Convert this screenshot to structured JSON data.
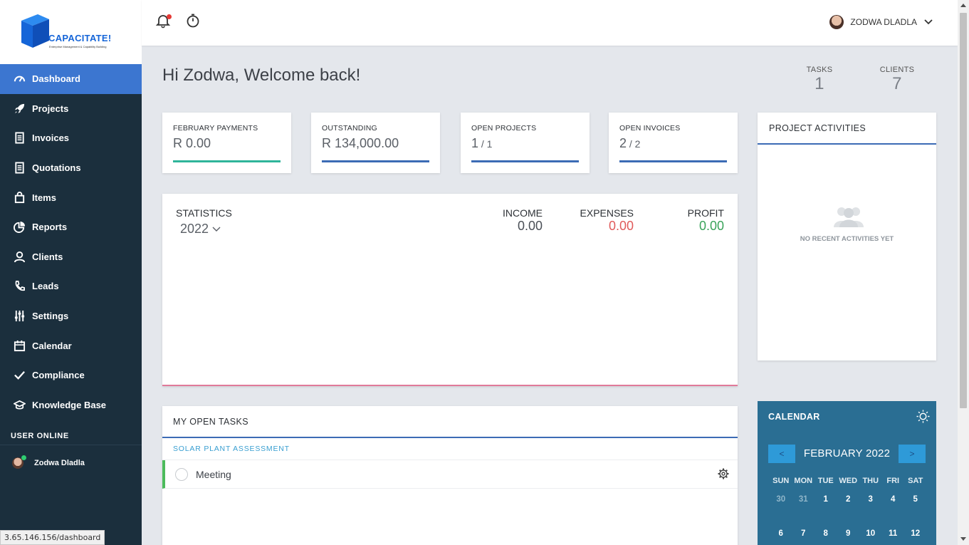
{
  "brand": {
    "name": "CAPACITATE!",
    "tagline": "Enterprise Management & Capability Building",
    "color": "#1565d8"
  },
  "sidebar": {
    "items": [
      {
        "label": "Dashboard",
        "icon": "speedometer-icon",
        "active": true
      },
      {
        "label": "Projects",
        "icon": "rocket-icon"
      },
      {
        "label": "Invoices",
        "icon": "document-icon"
      },
      {
        "label": "Quotations",
        "icon": "document-icon"
      },
      {
        "label": "Items",
        "icon": "bag-icon"
      },
      {
        "label": "Reports",
        "icon": "pie-chart-icon"
      },
      {
        "label": "Clients",
        "icon": "user-icon"
      },
      {
        "label": "Leads",
        "icon": "phone-icon"
      },
      {
        "label": "Settings",
        "icon": "sliders-icon"
      },
      {
        "label": "Calendar",
        "icon": "calendar-icon"
      },
      {
        "label": "Compliance",
        "icon": "check-icon"
      },
      {
        "label": "Knowledge Base",
        "icon": "graduation-cap-icon"
      }
    ],
    "user_online_title": "USER ONLINE",
    "online_user": "Zodwa Dladla"
  },
  "status_url": "3.65.146.156/dashboard",
  "topbar": {
    "user_name": "ZODWA DLADLA"
  },
  "welcome": "Hi Zodwa, Welcome back!",
  "counters": {
    "tasks": {
      "label": "TASKS",
      "value": "1"
    },
    "clients": {
      "label": "CLIENTS",
      "value": "7"
    }
  },
  "cards": [
    {
      "label": "FEBRUARY PAYMENTS",
      "value": "R 0.00",
      "sub": ""
    },
    {
      "label": "OUTSTANDING",
      "value": "R 134,000.00",
      "sub": ""
    },
    {
      "label": "OPEN PROJECTS",
      "value": "1",
      "sub": " / 1"
    },
    {
      "label": "OPEN INVOICES",
      "value": "2",
      "sub": " / 2"
    }
  ],
  "statistics": {
    "title": "STATISTICS",
    "year": "2022",
    "income": {
      "label": "INCOME",
      "value": "0.00",
      "color": "#4a4f56"
    },
    "expenses": {
      "label": "EXPENSES",
      "value": "0.00",
      "color": "#e05a5a"
    },
    "profit": {
      "label": "PROFIT",
      "value": "0.00",
      "color": "#3aa35a"
    }
  },
  "activities": {
    "title": "PROJECT ACTIVITIES",
    "empty_text": "NO RECENT ACTIVITIES YET"
  },
  "tasks": {
    "title": "MY OPEN TASKS",
    "project": "SOLAR PLANT ASSESSMENT",
    "items": [
      {
        "name": "Meeting"
      }
    ]
  },
  "calendar": {
    "title": "CALENDAR",
    "month": "FEBRUARY 2022",
    "prev": "<",
    "next": ">",
    "dow": [
      "SUN",
      "MON",
      "TUE",
      "WED",
      "THU",
      "FRI",
      "SAT"
    ],
    "days": [
      "30",
      "31",
      "1",
      "2",
      "3",
      "4",
      "5",
      "6",
      "7",
      "8",
      "9",
      "10",
      "11",
      "12"
    ]
  }
}
